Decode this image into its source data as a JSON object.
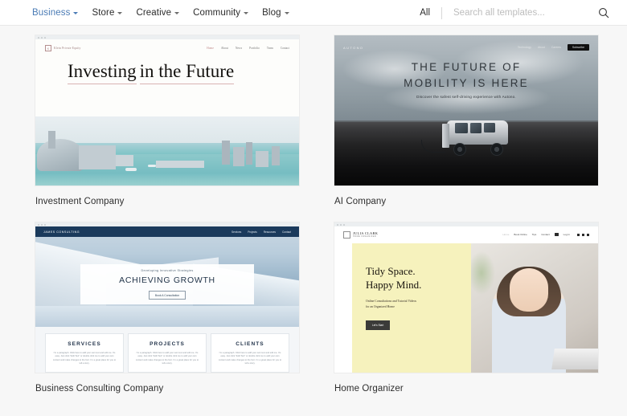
{
  "topnav": {
    "menu": [
      {
        "label": "Business",
        "active": true,
        "caret": true
      },
      {
        "label": "Store",
        "active": false,
        "caret": true
      },
      {
        "label": "Creative",
        "active": false,
        "caret": true
      },
      {
        "label": "Community",
        "active": false,
        "caret": true
      },
      {
        "label": "Blog",
        "active": false,
        "caret": true
      }
    ],
    "filter_label": "All",
    "search_placeholder": "Search all templates...",
    "search_value": "",
    "search_icon": "search-icon",
    "accent_color": "#4a7bb5"
  },
  "cards": [
    {
      "title": "Investment Company",
      "site": {
        "brand": "Klein Private Equity",
        "menu": [
          "Home",
          "About",
          "News",
          "Portfolio",
          "Team",
          "Contact"
        ],
        "active_menu": "Home",
        "heading_line1": "Investing",
        "heading_line2": "in the Future",
        "underline_color": "#d9b3b3"
      }
    },
    {
      "title": "AI Company",
      "site": {
        "brand": "AUTONO",
        "menu": [
          "Technology",
          "About",
          "Careers"
        ],
        "button": "Subscribe",
        "heading_line1": "THE FUTURE OF",
        "heading_line2": "MOBILITY IS HERE",
        "subtitle": "Discover the safest self-driving experience with Autono."
      }
    },
    {
      "title": "Business Consulting Company",
      "site": {
        "brand": "JAMES CONSULTING",
        "menu": [
          "Services",
          "Projects",
          "Resources",
          "Contact"
        ],
        "kicker": "Developing Innovative Strategies",
        "heading": "ACHIEVING GROWTH",
        "button": "Book A Consultation",
        "bar_color": "#1b3a5c",
        "columns": [
          {
            "heading": "SERVICES",
            "body": "I'm a paragraph. Click here to add your own text and edit me. It's easy. Just click \"Edit Text\" or double click me to add your own content and make changes to the font. I'm a great place for you to tell a story."
          },
          {
            "heading": "PROJECTS",
            "body": "I'm a paragraph. Click here to add your own text and edit me. It's easy. Just click \"Edit Text\" or double click me to add your own content and make changes to the font. I'm a great place for you to tell a story."
          },
          {
            "heading": "CLIENTS",
            "body": "I'm a paragraph. Click here to add your own text and edit me. It's easy. Just click \"Edit Text\" or double click me to add your own content and make changes to the font. I'm a great place for you to tell a story."
          }
        ]
      }
    },
    {
      "title": "Home Organizer",
      "site": {
        "brand": "JULIA CLARK",
        "brand_tagline": "HOME ORGANIZER",
        "menu": [
          "Home",
          "Book Online",
          "Tips",
          "Contact"
        ],
        "active_menu": "Home",
        "login_label": "Log In",
        "heading_line1": "Tidy Space.",
        "heading_line2": "Happy Mind.",
        "subtitle_line1": "Online Consultations and Tutorial Videos",
        "subtitle_line2": "for an Organized Home",
        "button": "Let's Start",
        "panel_color": "#f6f2bd"
      }
    }
  ]
}
